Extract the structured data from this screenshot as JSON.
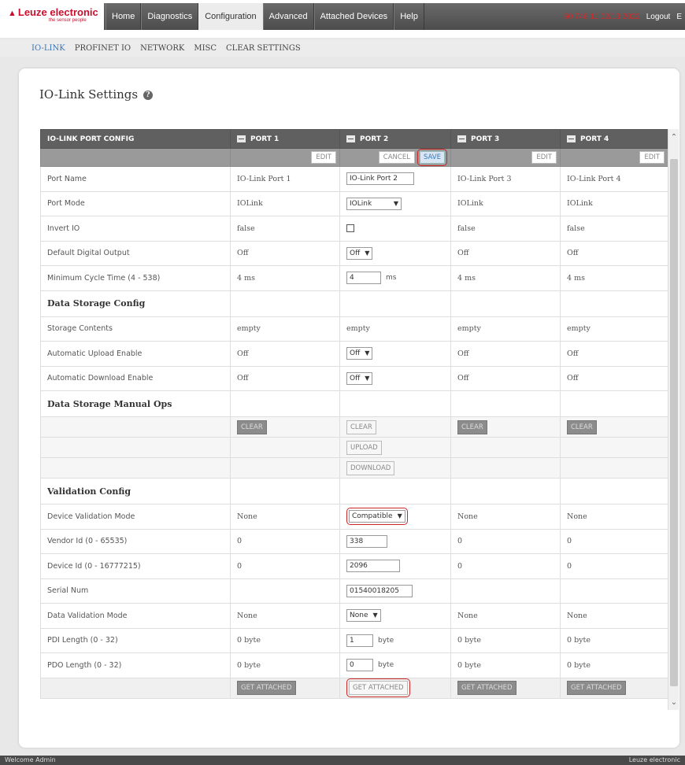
{
  "brand": {
    "name": "Leuze electronic",
    "tagline": "the sensor people"
  },
  "nav": {
    "tabs": [
      "Home",
      "Diagnostics",
      "Configuration",
      "Advanced",
      "Attached Devices",
      "Help"
    ]
  },
  "top_right": {
    "serial": "60 748 11 02/13 2022",
    "logout": "Logout",
    "lang": "E"
  },
  "subnav": {
    "items": [
      "IO-LINK",
      "PROFINET IO",
      "NETWORK",
      "MISC",
      "CLEAR SETTINGS"
    ]
  },
  "page": {
    "title": "IO-Link Settings"
  },
  "table": {
    "header": {
      "config": "IO-LINK PORT CONFIG",
      "ports": [
        "PORT 1",
        "PORT 2",
        "PORT 3",
        "PORT 4"
      ]
    },
    "buttons": {
      "edit": "EDIT",
      "cancel": "CANCEL",
      "save": "SAVE",
      "clear": "CLEAR",
      "upload": "UPLOAD",
      "download": "DOWNLOAD",
      "get_attached": "GET ATTACHED"
    },
    "sections": {
      "data_storage_config": "Data Storage Config",
      "data_storage_manual_ops": "Data Storage Manual Ops",
      "validation_config": "Validation Config"
    },
    "rows": {
      "port_name": {
        "label": "Port Name",
        "p1": "IO-Link Port 1",
        "p2": "IO-Link Port 2",
        "p3": "IO-Link Port 3",
        "p4": "IO-Link Port 4"
      },
      "port_mode": {
        "label": "Port Mode",
        "p1": "IOLink",
        "p2": "IOLink",
        "p3": "IOLink",
        "p4": "IOLink"
      },
      "invert_io": {
        "label": "Invert IO",
        "p1": "false",
        "p3": "false",
        "p4": "false"
      },
      "default_digital_output": {
        "label": "Default Digital Output",
        "p1": "Off",
        "p2": "Off",
        "p3": "Off",
        "p4": "Off"
      },
      "min_cycle_time": {
        "label": "Minimum Cycle Time (4 - 538)",
        "p1": "4 ms",
        "p2": "4",
        "p2_unit": "ms",
        "p3": "4 ms",
        "p4": "4 ms"
      },
      "storage_contents": {
        "label": "Storage Contents",
        "p1": "empty",
        "p2": "empty",
        "p3": "empty",
        "p4": "empty"
      },
      "auto_upload": {
        "label": "Automatic Upload Enable",
        "p1": "Off",
        "p2": "Off",
        "p3": "Off",
        "p4": "Off"
      },
      "auto_download": {
        "label": "Automatic Download Enable",
        "p1": "Off",
        "p2": "Off",
        "p3": "Off",
        "p4": "Off"
      },
      "device_validation_mode": {
        "label": "Device Validation Mode",
        "p1": "None",
        "p2": "Compatible",
        "p3": "None",
        "p4": "None"
      },
      "vendor_id": {
        "label": "Vendor Id (0 - 65535)",
        "p1": "0",
        "p2": "338",
        "p3": "0",
        "p4": "0"
      },
      "device_id": {
        "label": "Device Id (0 - 16777215)",
        "p1": "0",
        "p2": "2096",
        "p3": "0",
        "p4": "0"
      },
      "serial_num": {
        "label": "Serial Num",
        "p2": "01540018205"
      },
      "data_validation_mode": {
        "label": "Data Validation Mode",
        "p1": "None",
        "p2": "None",
        "p3": "None",
        "p4": "None"
      },
      "pdi_length": {
        "label": "PDI Length (0 - 32)",
        "p1": "0 byte",
        "p2": "1",
        "p2_unit": "byte",
        "p3": "0 byte",
        "p4": "0 byte"
      },
      "pdo_length": {
        "label": "PDO Length (0 - 32)",
        "p1": "0 byte",
        "p2": "0",
        "p2_unit": "byte",
        "p3": "0 byte",
        "p4": "0 byte"
      }
    }
  },
  "footer": {
    "left": "Welcome Admin",
    "right": "Leuze electronic"
  },
  "colors": {
    "brand_red": "#c8102e",
    "nav_bg": "#555555",
    "header_bg": "#606060",
    "highlight": "#c82828",
    "link_blue": "#3a76b8"
  }
}
